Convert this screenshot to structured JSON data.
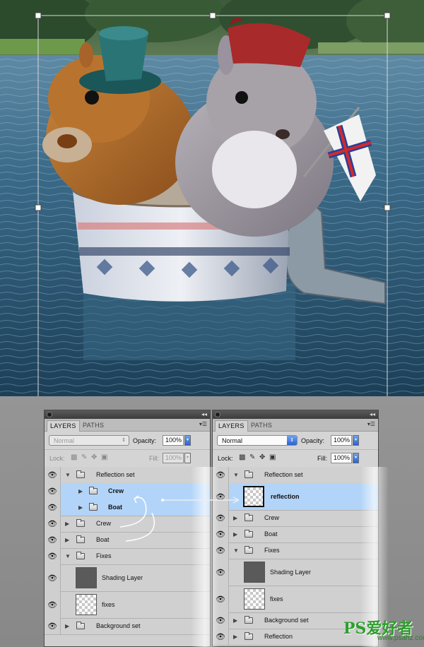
{
  "left_panel": {
    "tabs": [
      "LAYERS",
      "PATHS"
    ],
    "blend_mode": "Normal",
    "opacity_label": "Opacity:",
    "opacity_value": "100%",
    "lock_label": "Lock:",
    "fill_label": "Fill:",
    "fill_value": "100%",
    "layers": [
      {
        "name": "Reflection set",
        "type": "group",
        "expanded": true
      },
      {
        "name": "Crew",
        "type": "group",
        "selected": true
      },
      {
        "name": "Boat",
        "type": "group",
        "selected": true
      },
      {
        "name": "Crew",
        "type": "group"
      },
      {
        "name": "Boat",
        "type": "group"
      },
      {
        "name": "Fixes",
        "type": "group",
        "expanded": true
      },
      {
        "name": "Shading Layer",
        "type": "layer"
      },
      {
        "name": "fixes",
        "type": "layer"
      },
      {
        "name": "Background set",
        "type": "group"
      }
    ]
  },
  "right_panel": {
    "tabs": [
      "LAYERS",
      "PATHS"
    ],
    "blend_mode": "Normal",
    "opacity_label": "Opacity:",
    "opacity_value": "100%",
    "lock_label": "Lock:",
    "fill_label": "Fill:",
    "fill_value": "100%",
    "layers": [
      {
        "name": "Reflection set",
        "type": "group",
        "expanded": true
      },
      {
        "name": "reflection",
        "type": "layer",
        "selected": true
      },
      {
        "name": "Crew",
        "type": "group"
      },
      {
        "name": "Boat",
        "type": "group"
      },
      {
        "name": "Fixes",
        "type": "group",
        "expanded": true
      },
      {
        "name": "Shading Layer",
        "type": "layer"
      },
      {
        "name": "fixes",
        "type": "layer"
      },
      {
        "name": "Background set",
        "type": "group"
      },
      {
        "name": "Reflection",
        "type": "group"
      }
    ]
  },
  "watermark": {
    "main": "PS爱好者",
    "sub": "www.psahz.com"
  },
  "colors": {
    "selection": "#b2d4f8",
    "panel": "#d4d4d4",
    "water": "#2f5f7a"
  }
}
